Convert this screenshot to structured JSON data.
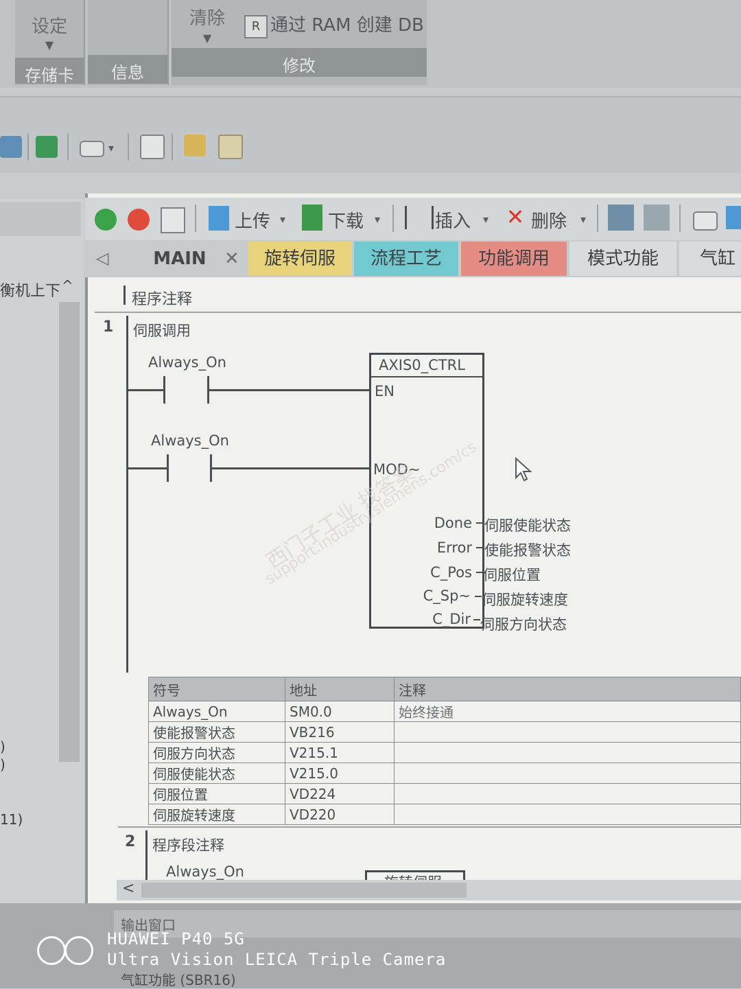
{
  "ribbon": {
    "groups": [
      {
        "button": "设定",
        "caption": "存储卡"
      },
      {
        "button": "",
        "caption": "信息"
      },
      {
        "button": "清除",
        "caption": "修改"
      }
    ],
    "ram_db_label": "通过 RAM 创建 DB"
  },
  "editor_toolbar": {
    "upload_label": "上传",
    "download_label": "下载",
    "insert_label": "插入",
    "delete_label": "删除"
  },
  "left_panel": {
    "tree_item": "衡机上下",
    "fragment_a": ")",
    "fragment_b": ")",
    "fragment_c": "11)"
  },
  "tabs": [
    {
      "label": "MAIN",
      "color": "#c8cbcc"
    },
    {
      "label": "旋转伺服",
      "color": "#e8d27a"
    },
    {
      "label": "流程工艺",
      "color": "#72c9cf"
    },
    {
      "label": "功能调用",
      "color": "#e58d84"
    },
    {
      "label": "模式功能",
      "color": "#d9dcdc"
    },
    {
      "label": "气缸F",
      "color": "#d9dcdc"
    }
  ],
  "program": {
    "comment": "程序注释",
    "networks": [
      {
        "number": "1",
        "title": "伺服调用"
      },
      {
        "number": "2",
        "title": "程序段注释"
      }
    ]
  },
  "network1": {
    "contact1": "Always_On",
    "contact2": "Always_On",
    "block_name": "AXIS0_CTRL",
    "pin_en": "EN",
    "pin_mod": "MOD~",
    "outputs": [
      {
        "pin": "Done",
        "signal": "伺服使能状态"
      },
      {
        "pin": "Error",
        "signal": "使能报警状态"
      },
      {
        "pin": "C_Pos",
        "signal": "伺服位置"
      },
      {
        "pin": "C_Sp~",
        "signal": "伺服旋转速度"
      },
      {
        "pin": "C_Dir",
        "signal": "伺服方向状态"
      }
    ]
  },
  "symbol_table": {
    "headers": [
      "符号",
      "地址",
      "注释"
    ],
    "rows": [
      [
        "Always_On",
        "SM0.0",
        "始终接通"
      ],
      [
        "使能报警状态",
        "VB216",
        ""
      ],
      [
        "伺服方向状态",
        "V215.1",
        ""
      ],
      [
        "伺服使能状态",
        "V215.0",
        ""
      ],
      [
        "伺服位置",
        "VD224",
        ""
      ],
      [
        "伺服旋转速度",
        "VD220",
        ""
      ]
    ]
  },
  "network2": {
    "contact": "Always_On",
    "block": "旋转伺服"
  },
  "output_window": {
    "title": "输出窗口",
    "item": "气缸功能 (SBR16)"
  },
  "watermark": {
    "line1": "西门子工业 找答案",
    "line2": "support.industry.siemens.com/cs"
  },
  "camera_overlay": {
    "line1": "HUAWEI P40 5G",
    "line2": "Ultra Vision LEICA Triple Camera"
  }
}
